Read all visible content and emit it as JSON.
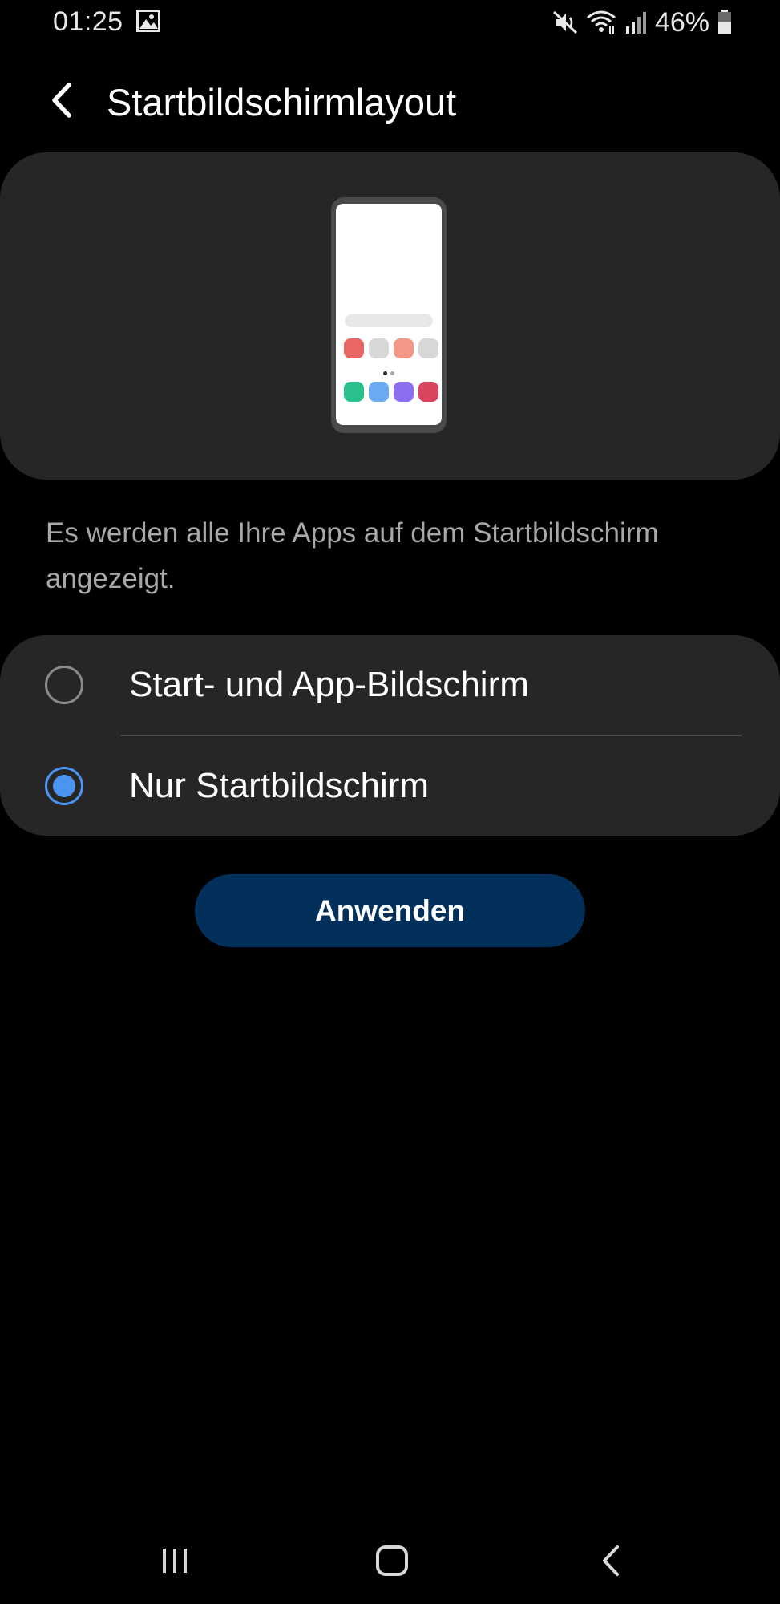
{
  "status_bar": {
    "time": "01:25",
    "battery": "46%",
    "icons": [
      "gallery-icon",
      "mute-icon",
      "wifi-icon",
      "signal-icon",
      "battery-icon"
    ]
  },
  "header": {
    "back_icon": "chevron-left-icon",
    "title": "Startbildschirmlayout"
  },
  "preview": {
    "icon": "phone-preview-illustration",
    "app_colors": [
      "#e86664",
      "#d8d8d8",
      "#f19886",
      "#d8d8d8",
      "#2bbf8b",
      "#6aaaf3",
      "#8c6ef0",
      "#d9445e"
    ]
  },
  "description": "Es werden alle Ihre Apps auf dem Startbildschirm angezeigt.",
  "options": [
    {
      "label": "Start- und App-Bildschirm",
      "selected": false
    },
    {
      "label": "Nur Startbildschirm",
      "selected": true
    }
  ],
  "apply_label": "Anwenden",
  "colors": {
    "accent": "#4b95f0",
    "button": "#03305a",
    "card": "#262626",
    "background": "#000000"
  },
  "nav_bar": {
    "items": [
      "recents-icon",
      "home-icon",
      "back-icon"
    ]
  }
}
